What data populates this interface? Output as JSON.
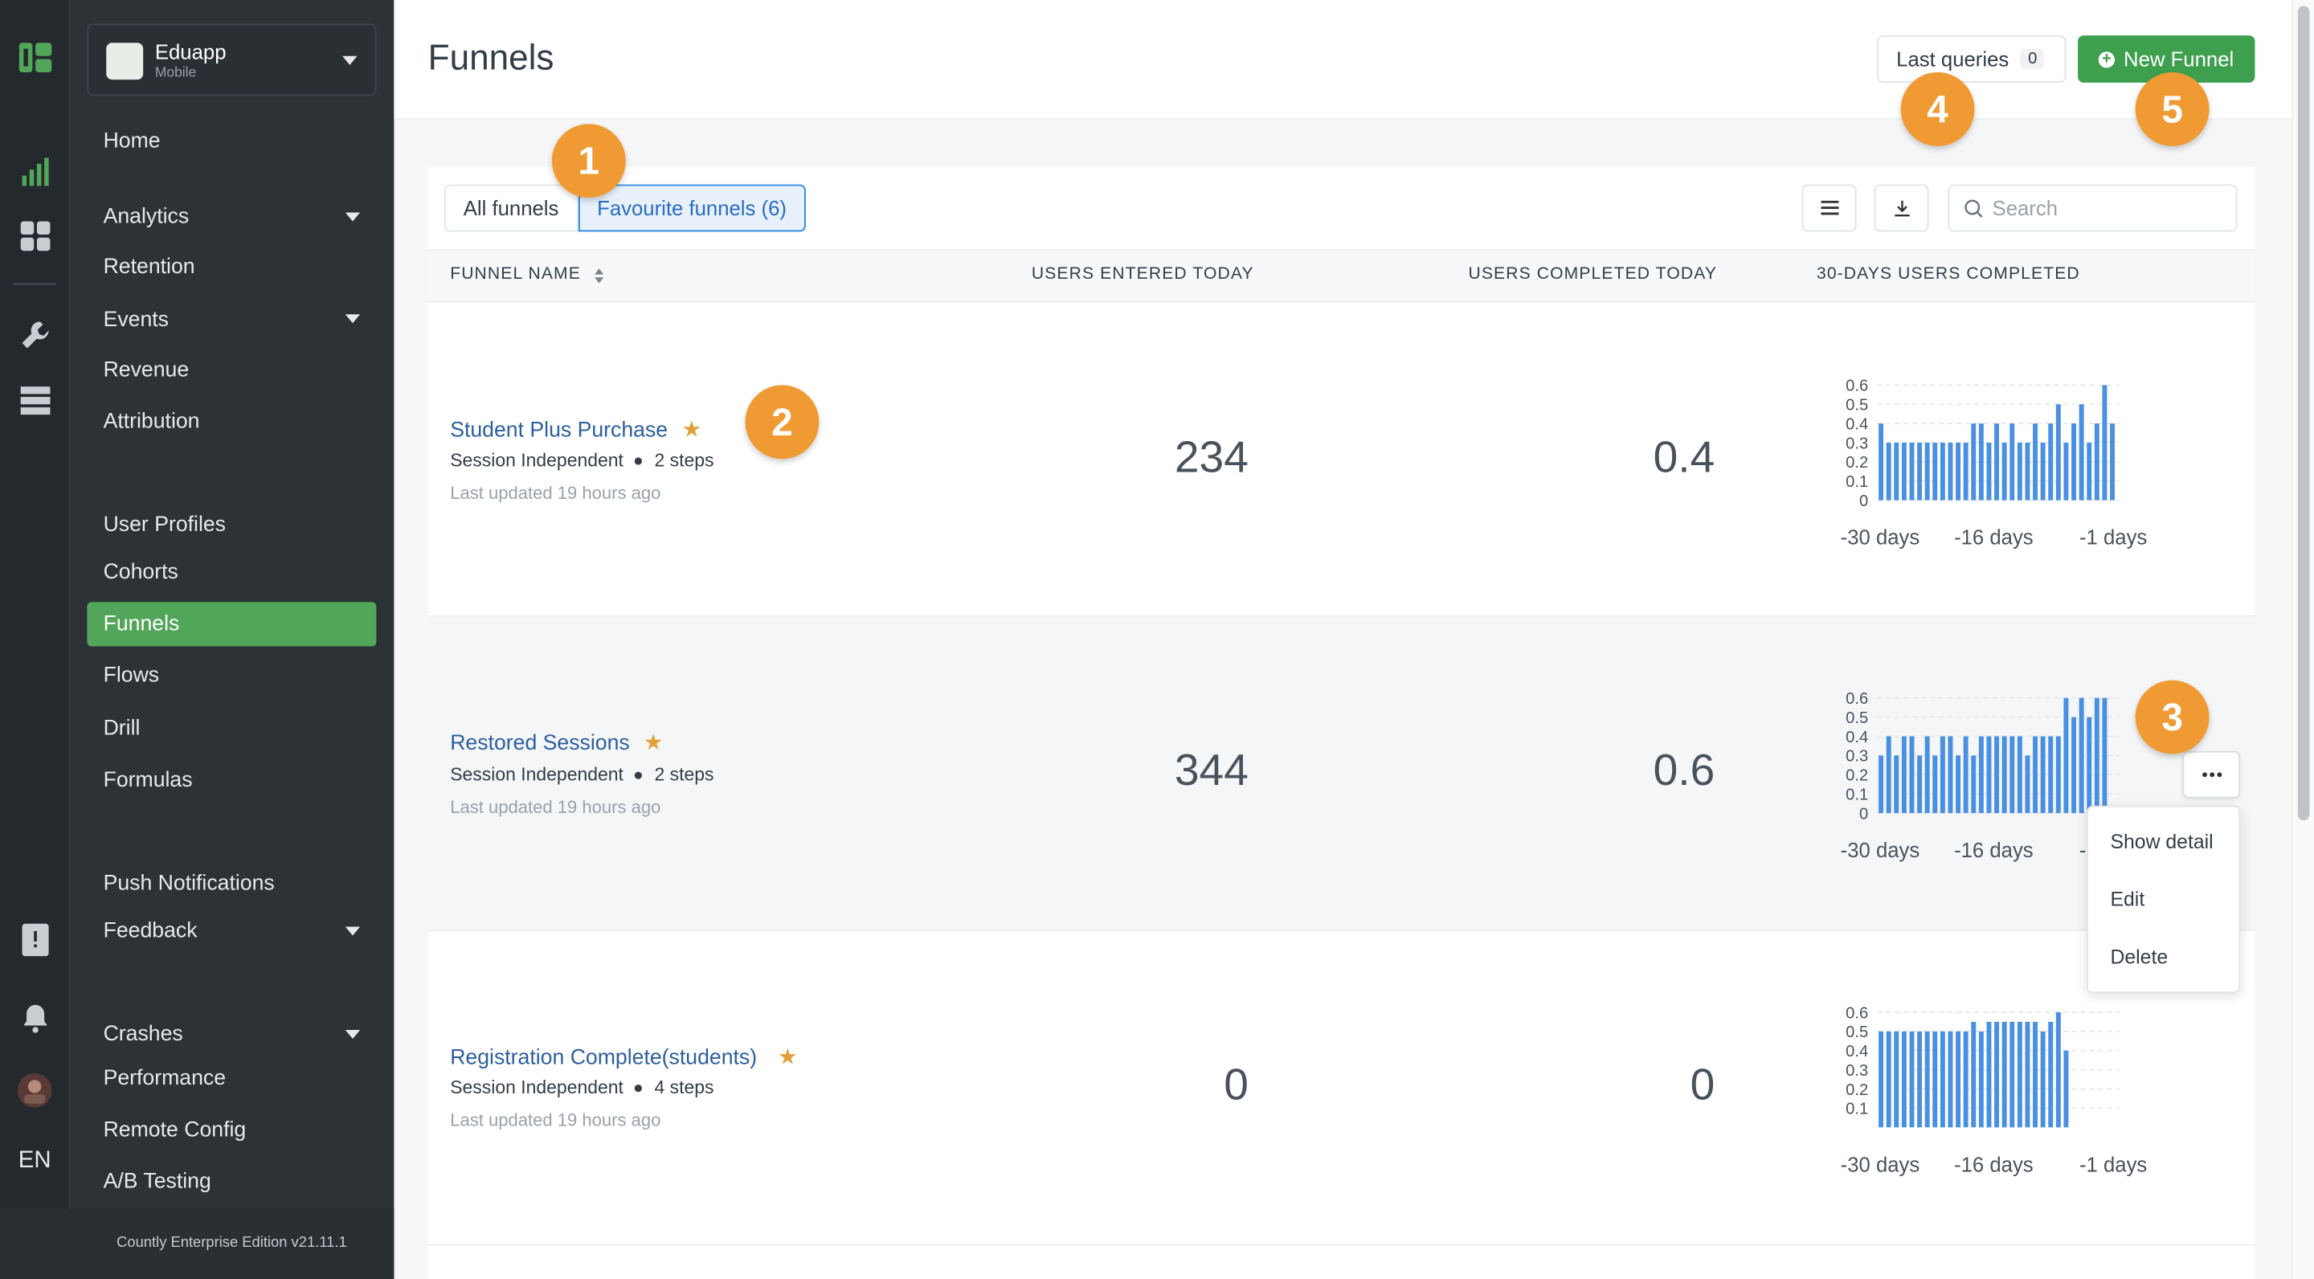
{
  "app": {
    "name": "Eduapp",
    "platform": "Mobile"
  },
  "rail_icons": [
    "countly-logo-icon",
    "analytics-bars-icon",
    "dashboard-grid-icon",
    "wrench-icon",
    "database-icon",
    "report-icon",
    "bell-icon",
    "avatar",
    "language"
  ],
  "language": "EN",
  "sidebar": {
    "items": [
      {
        "label": "Home"
      },
      {
        "label": "Analytics",
        "expandable": true
      },
      {
        "label": "Retention"
      },
      {
        "label": "Events",
        "expandable": true
      },
      {
        "label": "Revenue"
      },
      {
        "label": "Attribution"
      },
      {
        "label": "User Profiles"
      },
      {
        "label": "Cohorts"
      },
      {
        "label": "Funnels",
        "active": true
      },
      {
        "label": "Flows"
      },
      {
        "label": "Drill"
      },
      {
        "label": "Formulas"
      },
      {
        "label": "Push Notifications"
      },
      {
        "label": "Feedback",
        "expandable": true
      },
      {
        "label": "Crashes",
        "expandable": true
      },
      {
        "label": "Performance"
      },
      {
        "label": "Remote Config"
      },
      {
        "label": "A/B Testing"
      }
    ],
    "edition": "Countly Enterprise Edition v21.11.1"
  },
  "header": {
    "title": "Funnels",
    "last_queries_label": "Last queries",
    "last_queries_count": "0",
    "new_funnel_label": "New Funnel"
  },
  "tabs": [
    {
      "label": "All funnels",
      "selected": false
    },
    {
      "label": "Favourite funnels (6)",
      "selected": true
    }
  ],
  "search": {
    "placeholder": "Search"
  },
  "table": {
    "columns": [
      "FUNNEL NAME",
      "USERS ENTERED TODAY",
      "USERS COMPLETED TODAY",
      "30-DAYS USERS COMPLETED"
    ],
    "rows": [
      {
        "name": "Student Plus Purchase",
        "favourite": true,
        "session": "Session Independent",
        "steps": "2 steps",
        "updated": "Last updated 19 hours ago",
        "entered": "234",
        "completed": "0.4"
      },
      {
        "name": "Restored Sessions",
        "favourite": true,
        "session": "Session Independent",
        "steps": "2 steps",
        "updated": "Last updated 19 hours ago",
        "entered": "344",
        "completed": "0.6"
      },
      {
        "name": "Registration Complete(students)",
        "favourite": true,
        "session": "Session Independent",
        "steps": "4 steps",
        "updated": "Last updated 19 hours ago",
        "entered": "0",
        "completed": "0"
      }
    ]
  },
  "row_menu": {
    "items": [
      "Show detail",
      "Edit",
      "Delete"
    ]
  },
  "annotations": [
    "1",
    "2",
    "3",
    "4",
    "5"
  ],
  "colors": {
    "accent_green": "#52a65a",
    "bar_blue": "#4a90e2",
    "link_blue": "#2b5f9e",
    "badge_orange": "#f09a33"
  },
  "chart_data": [
    {
      "type": "bar",
      "title": "",
      "ylim": [
        0,
        0.6
      ],
      "yticks": [
        "0",
        "0.1",
        "0.2",
        "0.3",
        "0.4",
        "0.5",
        "0.6"
      ],
      "xticks": [
        "-30 days",
        "-16 days",
        "-1 days"
      ],
      "series": [
        {
          "values": [
            0.4,
            0.3,
            0.3,
            0.3,
            0.3,
            0.3,
            0.3,
            0.3,
            0.3,
            0.3,
            0.3,
            0.3,
            0.4,
            0.4,
            0.3,
            0.4,
            0.3,
            0.4,
            0.3,
            0.3,
            0.4,
            0.3,
            0.4,
            0.5,
            0.3,
            0.4,
            0.5,
            0.3,
            0.4,
            0.6,
            0.4
          ]
        }
      ]
    },
    {
      "type": "bar",
      "title": "",
      "ylim": [
        0,
        0.6
      ],
      "yticks": [
        "0",
        "0.1",
        "0.2",
        "0.3",
        "0.4",
        "0.5",
        "0.6"
      ],
      "xticks": [
        "-30 days",
        "-16 days",
        "-1 days"
      ],
      "series": [
        {
          "values": [
            0.3,
            0.4,
            0.3,
            0.4,
            0.4,
            0.3,
            0.4,
            0.3,
            0.4,
            0.4,
            0.3,
            0.4,
            0.3,
            0.4,
            0.4,
            0.4,
            0.4,
            0.4,
            0.4,
            0.3,
            0.4,
            0.4,
            0.4,
            0.4,
            0.6,
            0.5,
            0.6,
            0.5,
            0.6,
            0.6
          ]
        }
      ]
    },
    {
      "type": "bar",
      "title": "",
      "ylim": [
        0,
        0.6
      ],
      "yticks": [
        "0.1",
        "0.2",
        "0.3",
        "0.4",
        "0.5",
        "0.6"
      ],
      "xticks": [
        "-30 days",
        "-16 days",
        "-1 days"
      ],
      "series": [
        {
          "values": [
            0.5,
            0.5,
            0.5,
            0.5,
            0.5,
            0.5,
            0.5,
            0.5,
            0.5,
            0.5,
            0.5,
            0.5,
            0.55,
            0.5,
            0.55,
            0.55,
            0.55,
            0.55,
            0.55,
            0.55,
            0.55,
            0.5,
            0.55,
            0.6,
            0.4
          ]
        }
      ]
    }
  ]
}
